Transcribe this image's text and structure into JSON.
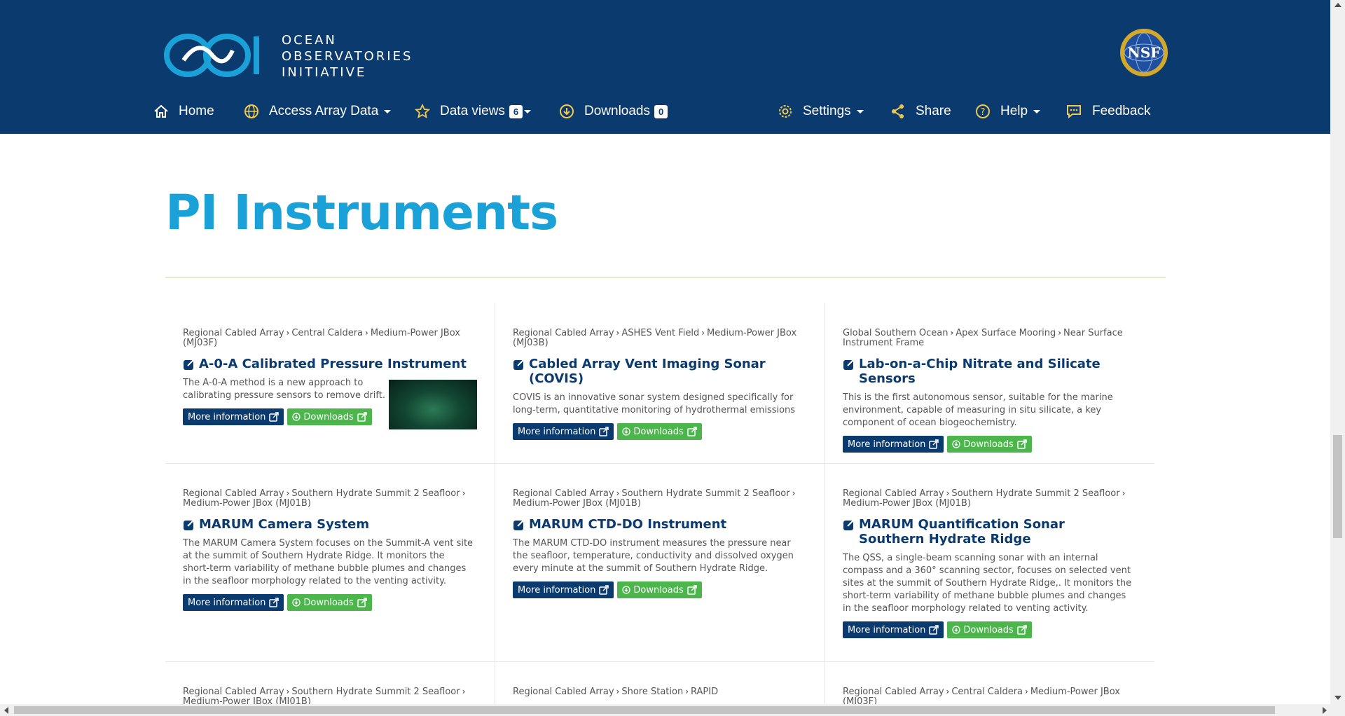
{
  "header": {
    "logo_lines": [
      "OCEAN",
      "OBSERVATORIES",
      "INITIATIVE"
    ],
    "nsf_label": "NSF",
    "nav": {
      "home": "Home",
      "access": "Access Array Data",
      "data_views": "Data views",
      "data_views_count": "6",
      "downloads": "Downloads",
      "downloads_count": "0",
      "settings": "Settings",
      "share": "Share",
      "help": "Help",
      "feedback": "Feedback"
    }
  },
  "page_title": "PI Instruments",
  "colors": {
    "navy": "#0b3a6e",
    "accent": "#1aa1d8",
    "green": "#4cb54c"
  },
  "button_labels": {
    "more_info": "More information",
    "downloads": "Downloads"
  },
  "cards": [
    {
      "breadcrumb": [
        "Regional Cabled Array",
        "Central Caldera",
        "Medium-Power JBox (MJ03F)"
      ],
      "title": "A-0-A Calibrated Pressure Instrument",
      "description": "The A-0-A method is a new approach to calibrating pressure sensors to remove drift."
    },
    {
      "breadcrumb": [
        "Regional Cabled Array",
        "ASHES Vent Field",
        "Medium-Power JBox (MJ03B)"
      ],
      "title": "Cabled Array Vent Imaging Sonar (COVIS)",
      "description": "COVIS is an innovative sonar system designed specifically for long-term, quantitative monitoring of hydrothermal emissions"
    },
    {
      "breadcrumb": [
        "Global Southern Ocean",
        "Apex Surface Mooring",
        "Near Surface Instrument Frame"
      ],
      "title": "Lab-on-a-Chip Nitrate and Silicate Sensors",
      "description": "This is the first autonomous sensor, suitable for the marine environment, capable of measuring in situ silicate, a key component of ocean biogeochemistry."
    },
    {
      "breadcrumb": [
        "Regional Cabled Array",
        "Southern Hydrate Summit 2 Seafloor",
        "Medium-Power JBox (MJ01B)"
      ],
      "title": "MARUM Camera System",
      "description": "The MARUM Camera System focuses on the Summit-A vent site at the summit of Southern Hydrate Ridge. It monitors the short-term variability of methane bubble plumes and changes in the seafloor morphology related to the venting activity."
    },
    {
      "breadcrumb": [
        "Regional Cabled Array",
        "Southern Hydrate Summit 2 Seafloor",
        "Medium-Power JBox (MJ01B)"
      ],
      "title": "MARUM CTD-DO Instrument",
      "description": "The MARUM CTD-DO instrument measures the pressure near the seafloor, temperature, conductivity and dissolved oxygen every minute at the summit of Southern Hydrate Ridge."
    },
    {
      "breadcrumb": [
        "Regional Cabled Array",
        "Southern Hydrate Summit 2 Seafloor",
        "Medium-Power JBox (MJ01B)"
      ],
      "title": "MARUM Quantification Sonar Southern Hydrate Ridge",
      "description": "The QSS, a single-beam scanning sonar with an internal compass and a 360° scanning sector, focuses on selected vent sites at the summit of Southern Hydrate Ridge,. It monitors the short-term variability of methane bubble plumes and changes in the seafloor morphology related to venting activity."
    },
    {
      "breadcrumb": [
        "Regional Cabled Array",
        "Southern Hydrate Summit 2 Seafloor",
        "Medium-Power JBox (MJ01B)"
      ]
    },
    {
      "breadcrumb": [
        "Regional Cabled Array",
        "Shore Station",
        "RAPID"
      ]
    },
    {
      "breadcrumb": [
        "Regional Cabled Array",
        "Central Caldera",
        "Medium-Power JBox (MJ03F)"
      ]
    }
  ]
}
